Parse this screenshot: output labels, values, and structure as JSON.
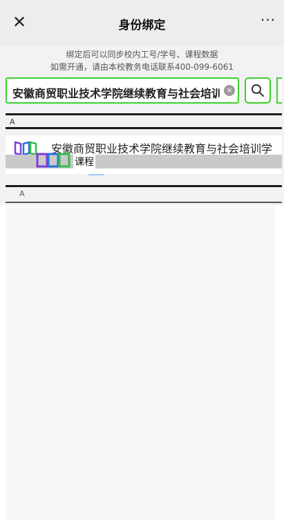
{
  "navbar": {
    "title": "身份绑定",
    "close_glyph": "✕",
    "more_glyph": "···"
  },
  "description": {
    "line1": "绑定后可以同步校内工号/学号、课程数据",
    "line2": "如需开通，请由本校教务电话联系400-099-6061"
  },
  "search": {
    "value": "安徽商贸职业技术学院继续教育与社会培训学院",
    "clear_glyph": "×"
  },
  "results": [
    {
      "name": "安徽商贸职业技术学院继续教育与社会培训学",
      "sub_name": "课程"
    }
  ],
  "section": {
    "index_letter": "A",
    "secondary_letter": "A"
  },
  "colors": {
    "accent": "#39d12b",
    "logo_purple": "#7b3fd6",
    "logo_blue": "#2a6fe0",
    "logo_green": "#2fbf4a"
  },
  "icons": {
    "close": "close-icon",
    "more": "more-icon",
    "search": "search-icon",
    "clear": "clear-icon",
    "school_logo": "school-logo-icon"
  }
}
